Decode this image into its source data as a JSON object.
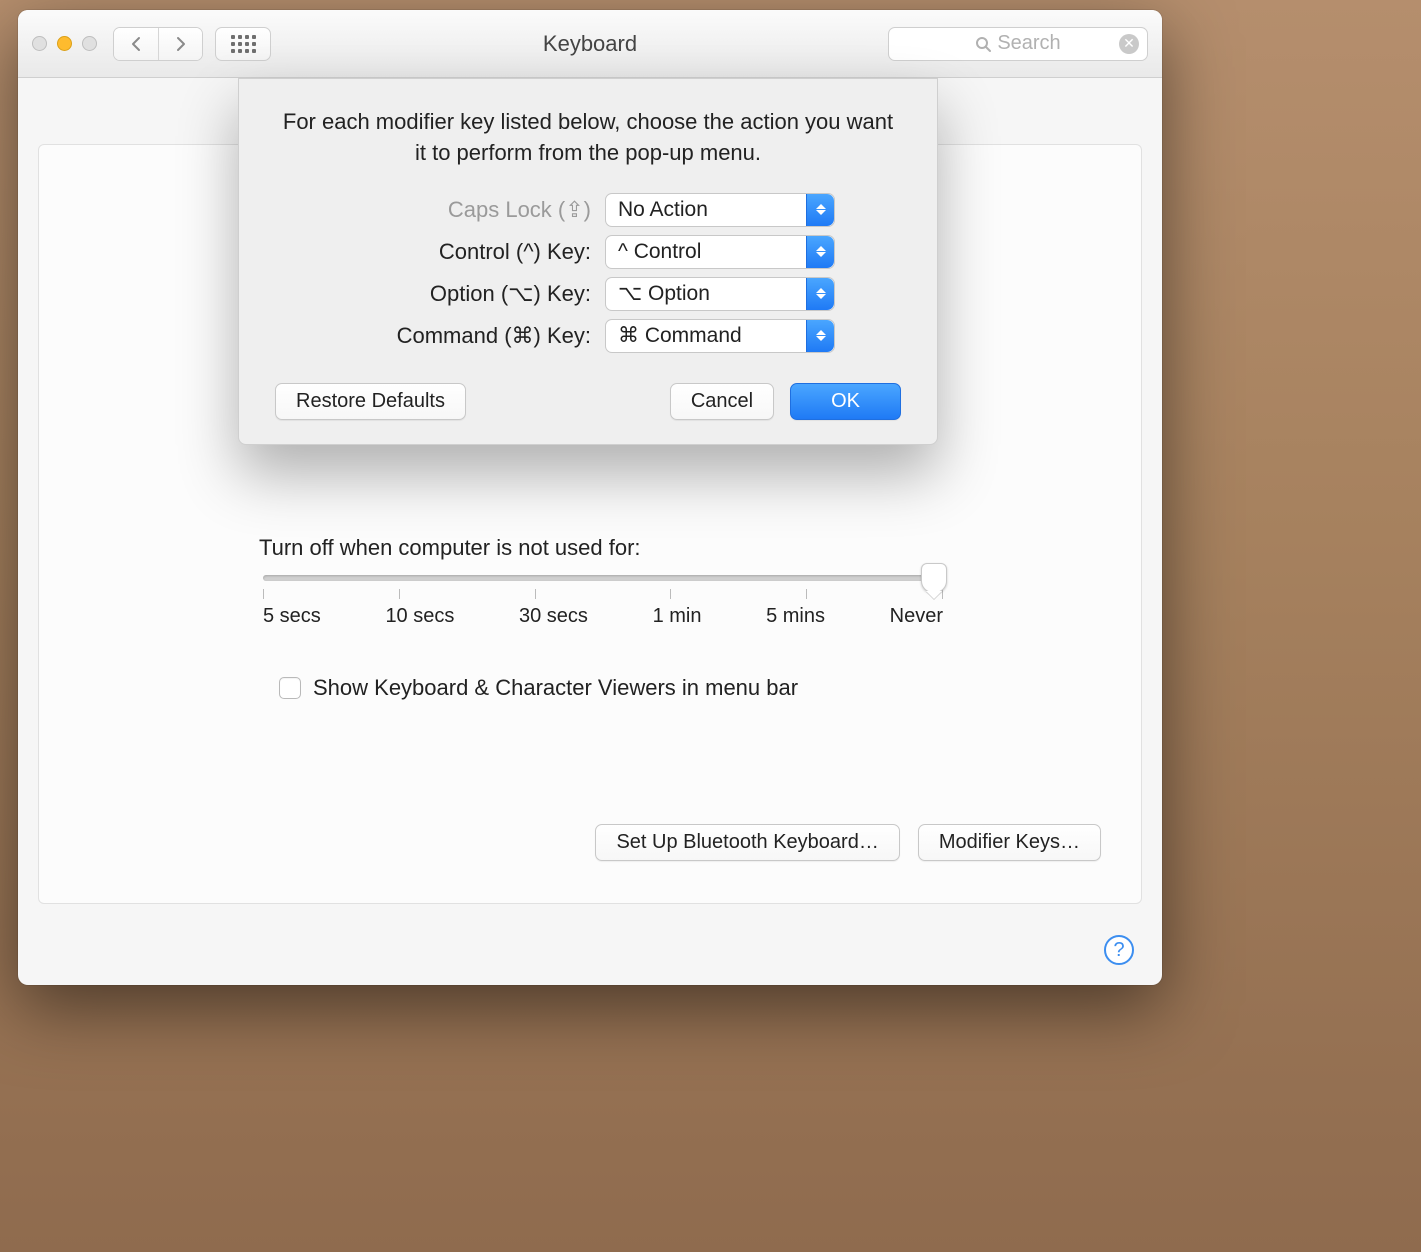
{
  "window": {
    "title": "Keyboard",
    "search_placeholder": "Search"
  },
  "sheet": {
    "intro": "For each modifier key listed below, choose the action you want it to perform from the pop-up menu.",
    "rows": [
      {
        "label": "Caps Lock (⇪)",
        "value": "No Action",
        "dim": true
      },
      {
        "label": "Control (^) Key:",
        "value": "^ Control",
        "dim": false
      },
      {
        "label": "Option (⌥) Key:",
        "value": "⌥ Option",
        "dim": false
      },
      {
        "label": "Command (⌘) Key:",
        "value": "⌘ Command",
        "dim": false
      }
    ],
    "restore": "Restore Defaults",
    "cancel": "Cancel",
    "ok": "OK"
  },
  "main": {
    "turnoff_label": "Turn off when computer is not used for:",
    "slider_labels": [
      "5 secs",
      "10 secs",
      "30 secs",
      "1 min",
      "5 mins",
      "Never"
    ],
    "checkbox_label": "Show Keyboard & Character Viewers in menu bar",
    "bluetooth_btn": "Set Up Bluetooth Keyboard…",
    "modifier_btn": "Modifier Keys…"
  },
  "help": "?"
}
